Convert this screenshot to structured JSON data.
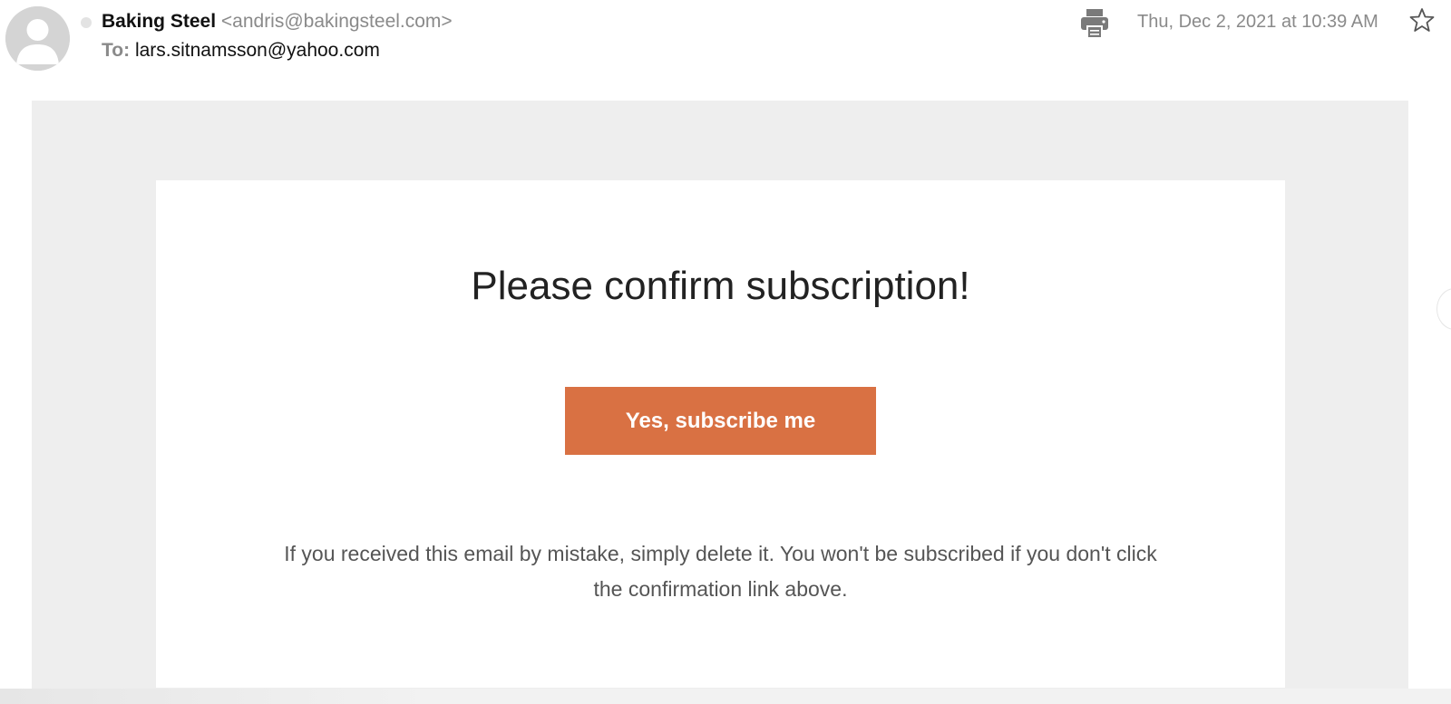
{
  "header": {
    "sender_name": "Baking Steel",
    "sender_email": "<andris@bakingsteel.com>",
    "to_label": "To:",
    "to_value": "lars.sitnamsson@yahoo.com",
    "date": "Thu, Dec 2, 2021 at 10:39 AM",
    "icons": [
      "avatar-icon",
      "print-icon",
      "star-icon"
    ]
  },
  "email": {
    "title": "Please confirm subscription!",
    "button_label": "Yes, subscribe me",
    "disclaimer": "If you received this email by mistake, simply delete it. You won't be subscribed if you don't click the confirmation link above."
  },
  "colors": {
    "accent": "#d97143",
    "outer_background": "#eeeeee"
  }
}
